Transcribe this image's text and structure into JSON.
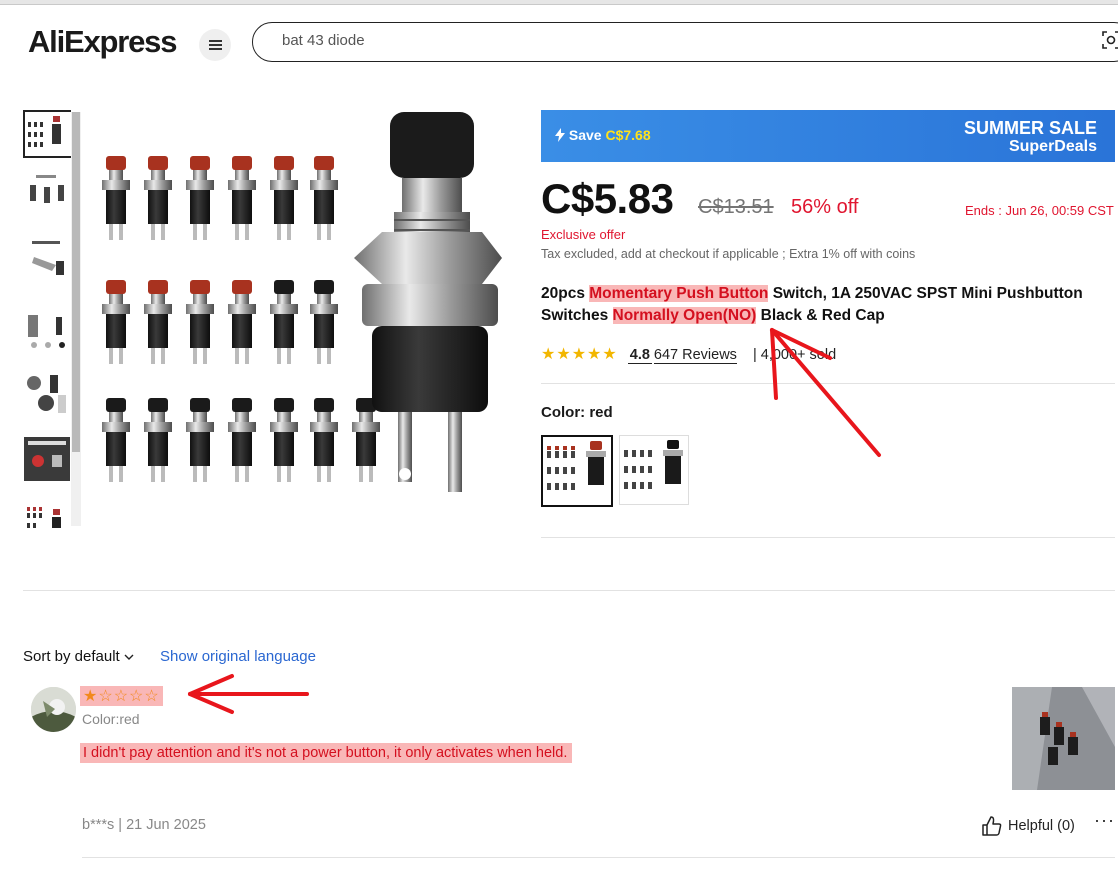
{
  "header": {
    "logo": "AliExpress",
    "search_value": "bat 43 diode"
  },
  "banner": {
    "save_prefix": "Save",
    "save_amount": "C$7.68",
    "title_line1": "SUMMER SALE",
    "title_line2": "SuperDeals"
  },
  "price": {
    "current": "C$5.83",
    "original": "C$13.51",
    "discount": "56% off",
    "ends": "Ends :  Jun 26, 00:59 CST",
    "exclusive": "Exclusive offer",
    "tax_note": "Tax excluded, add at checkout if applicable ; Extra 1% off with coins"
  },
  "product": {
    "title_part1": "20pcs ",
    "title_hl1": "Momentary Push Button",
    "title_part2": " Switch, 1A 250VAC SPST Mini Pushbutton Switches ",
    "title_hl2": "Normally Open(NO)",
    "title_part3": " Black & Red Cap",
    "rating": "4.8",
    "reviews": "647 Reviews",
    "sold": "4,000+ sold",
    "color_label": "Color: red",
    "stars": "★★★★★"
  },
  "reviews": {
    "sort_label": "Sort by default",
    "show_original": "Show original language",
    "item": {
      "stars": "★☆☆☆☆",
      "color": "Color:red",
      "text": "I didn't pay attention and it's not a power button, it only activates when held.",
      "author_date": "b***s | 21 Jun 2025",
      "helpful": "Helpful (0)",
      "more": "···"
    }
  },
  "colors": {
    "accent_red": "#e0152f",
    "highlight": "#f9b7b7",
    "link_blue": "#2a67d1",
    "banner_blue": "#3a8ee6",
    "star_yellow": "#f2b600"
  },
  "icons": [
    "menu-icon",
    "camera-search-icon",
    "lightning-icon",
    "chevron-down-icon",
    "thumbs-up-icon",
    "more-icon"
  ]
}
